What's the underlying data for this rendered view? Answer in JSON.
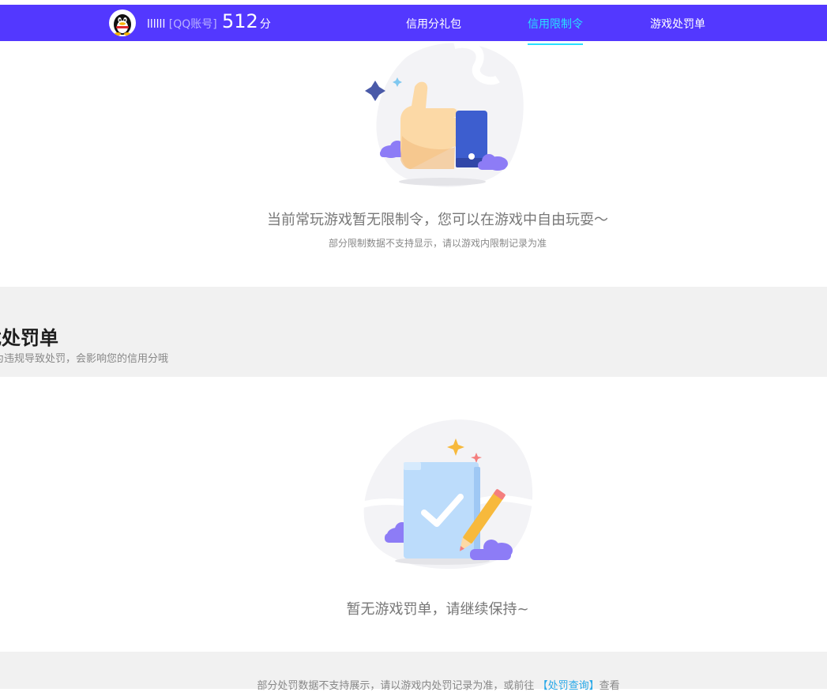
{
  "header": {
    "account_name": "llllll",
    "account_type": "[QQ账号]",
    "score_value": "512",
    "score_unit": "分",
    "tabs": [
      {
        "label": "信用分礼包",
        "active": false
      },
      {
        "label": "信用限制令",
        "active": true
      },
      {
        "label": "游戏处罚单",
        "active": false
      }
    ],
    "bg_color": "#5338ff",
    "active_color": "#28e1ff"
  },
  "restriction": {
    "illustration_icon": "thumbs-up-icon",
    "message": "当前常玩游戏暂无限制令，您可以在游戏中自由玩耍～",
    "note": "部分限制数据不支持显示，请以游戏内限制记录为准"
  },
  "penalty_section": {
    "title": "游戏处罚单",
    "title_visible": "戏处罚单",
    "subtitle": "为违规导致处罚，会影响您的信用分哦"
  },
  "penalty": {
    "illustration_icon": "clipboard-check-icon",
    "message": "暂无游戏罚单，请继续保持~"
  },
  "footer": {
    "note_prefix": "部分处罚数据不支持展示，请以游戏内处罚记录为准，或前往",
    "link_label": "【处罚查询】",
    "note_suffix": "查看"
  }
}
